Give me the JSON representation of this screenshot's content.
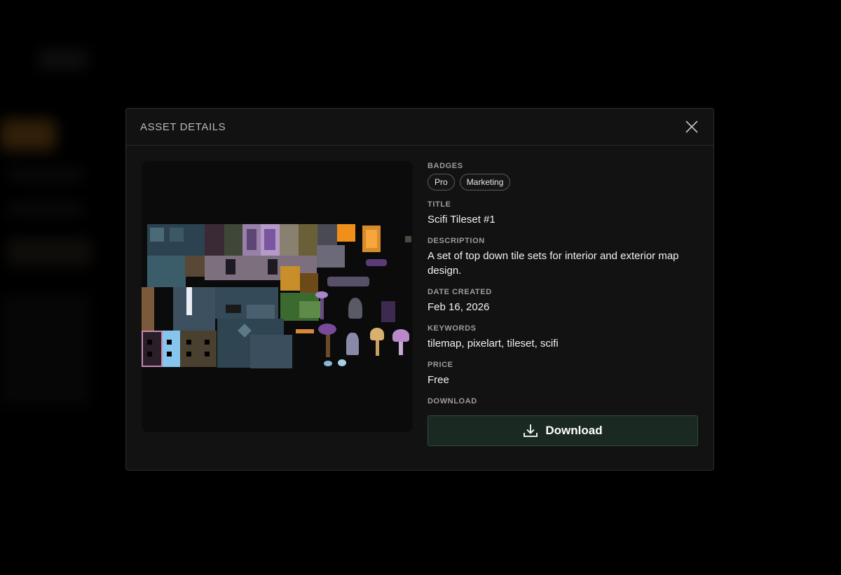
{
  "modal": {
    "title": "ASSET DETAILS"
  },
  "asset": {
    "badges_label": "BADGES",
    "badges": [
      "Pro",
      "Marketing"
    ],
    "title_label": "TITLE",
    "title": "Scifi Tileset #1",
    "description_label": "DESCRIPTION",
    "description": "A set of top down tile sets for interior and exterior map design.",
    "date_label": "DATE CREATED",
    "date": "Feb 16, 2026",
    "keywords_label": "KEYWORDS",
    "keywords": "tilemap, pixelart, tileset, scifi",
    "price_label": "PRICE",
    "price": "Free",
    "download_label": "DOWNLOAD",
    "download_button": "Download"
  },
  "icons": {
    "close": "close-icon",
    "download": "download-icon"
  },
  "colors": {
    "backdrop": "#000000",
    "modal_bg": "#121212",
    "download_bg": "#1a2a22"
  }
}
